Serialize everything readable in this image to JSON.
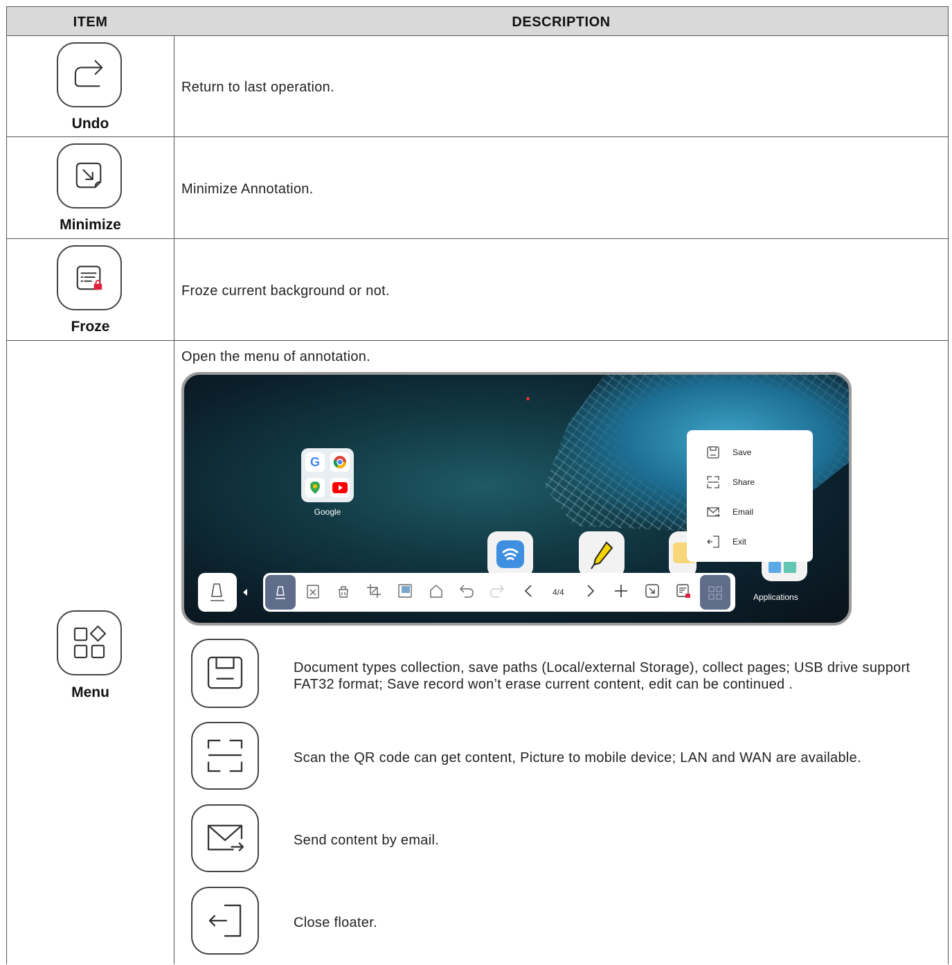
{
  "header": {
    "item": "ITEM",
    "description": "DESCRIPTION"
  },
  "rows": [
    {
      "label": "Undo",
      "icon": "redo-arrow-icon",
      "description": "Return to last operation."
    },
    {
      "label": "Minimize",
      "icon": "minimize-icon",
      "description": "Minimize Annotation."
    },
    {
      "label": "Froze",
      "icon": "freeze-background-icon",
      "description": "Froze current background or not."
    },
    {
      "label": "Menu",
      "icon": "menu-grid-icon",
      "description": "Open the menu of annotation."
    }
  ],
  "screenshot": {
    "folder_name": "Google",
    "apps_label": "Applications",
    "page_indicator": "4/4",
    "popup": [
      "Save",
      "Share",
      "Email",
      "Exit"
    ]
  },
  "menu_items": [
    {
      "icon": "save-icon",
      "text": "Document types collection, save paths (Local/external Storage), collect pages; USB drive support FAT32 format; Save record won’t erase current content, edit can be continued ."
    },
    {
      "icon": "share-qr-icon",
      "text": "Scan the QR code can get content, Picture to mobile device; LAN and WAN are available."
    },
    {
      "icon": "email-icon",
      "text": "Send content by email."
    },
    {
      "icon": "exit-icon",
      "text": "Close floater."
    }
  ],
  "colors": {
    "header_bg": "#d9d9d9",
    "border": "#555555",
    "toolbar_active": "#5f6d8a"
  }
}
